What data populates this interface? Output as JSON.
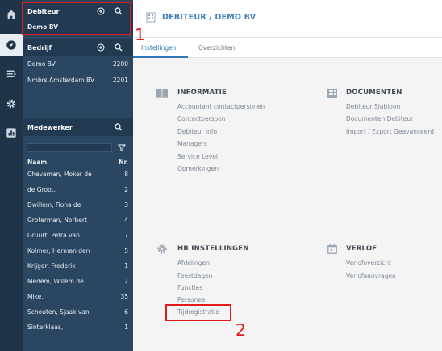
{
  "sidebar": {
    "debiteur": {
      "title": "Debiteur",
      "selected": "Demo BV"
    },
    "bedrijf": {
      "title": "Bedrijf",
      "rows": [
        {
          "name": "Demo BV",
          "num": "2200"
        },
        {
          "name": "Nmbrs Amsterdam BV",
          "num": "2201"
        }
      ]
    },
    "medewerker": {
      "title": "Medewerker",
      "col_name": "Naam",
      "col_num": "Nr.",
      "rows": [
        {
          "name": "Chevaman, Moker de",
          "num": "8"
        },
        {
          "name": "de Groot,",
          "num": "2"
        },
        {
          "name": "Dwillem, Fiona de",
          "num": "3"
        },
        {
          "name": "Groterman, Norbert",
          "num": "4"
        },
        {
          "name": "Gruurt, Petra van",
          "num": "7"
        },
        {
          "name": "Kolmer, Herman den",
          "num": "5"
        },
        {
          "name": "Krijger, Frederik",
          "num": "1"
        },
        {
          "name": "Medem, Willem de",
          "num": "2"
        },
        {
          "name": "Mike,",
          "num": "35"
        },
        {
          "name": "Schouten, Sjaak van",
          "num": "6"
        },
        {
          "name": "Sinterklaas,",
          "num": "1"
        }
      ]
    }
  },
  "header": {
    "breadcrumb": "DEBITEUR / DEMO BV"
  },
  "tabs": [
    "Instellingen",
    "Overzichten"
  ],
  "sections": {
    "informatie": {
      "title": "INFORMATIE",
      "links": [
        "Accountant contactpersonen",
        "Contactpersoon",
        "Debiteur info",
        "Managers",
        "Service Level",
        "Opmerkingen"
      ]
    },
    "documenten": {
      "title": "DOCUMENTEN",
      "links": [
        "Debiteur Sjabloon",
        "Documenten Debiteur",
        "Import / Export Geavanceerd"
      ]
    },
    "hr": {
      "title": "HR INSTELLINGEN",
      "links": [
        "Afdelingen",
        "Feestdagen",
        "Functies",
        "Personeel",
        "Tijdregistratie"
      ]
    },
    "verlof": {
      "title": "VERLOF",
      "links": [
        "Verlofoverzicht",
        "Verlofaanvragen"
      ]
    }
  },
  "annotations": [
    "1",
    "2"
  ],
  "colors": {
    "accent": "#2e78b6",
    "sidebar": "#2b4660",
    "highlight": "#e21b1b"
  }
}
